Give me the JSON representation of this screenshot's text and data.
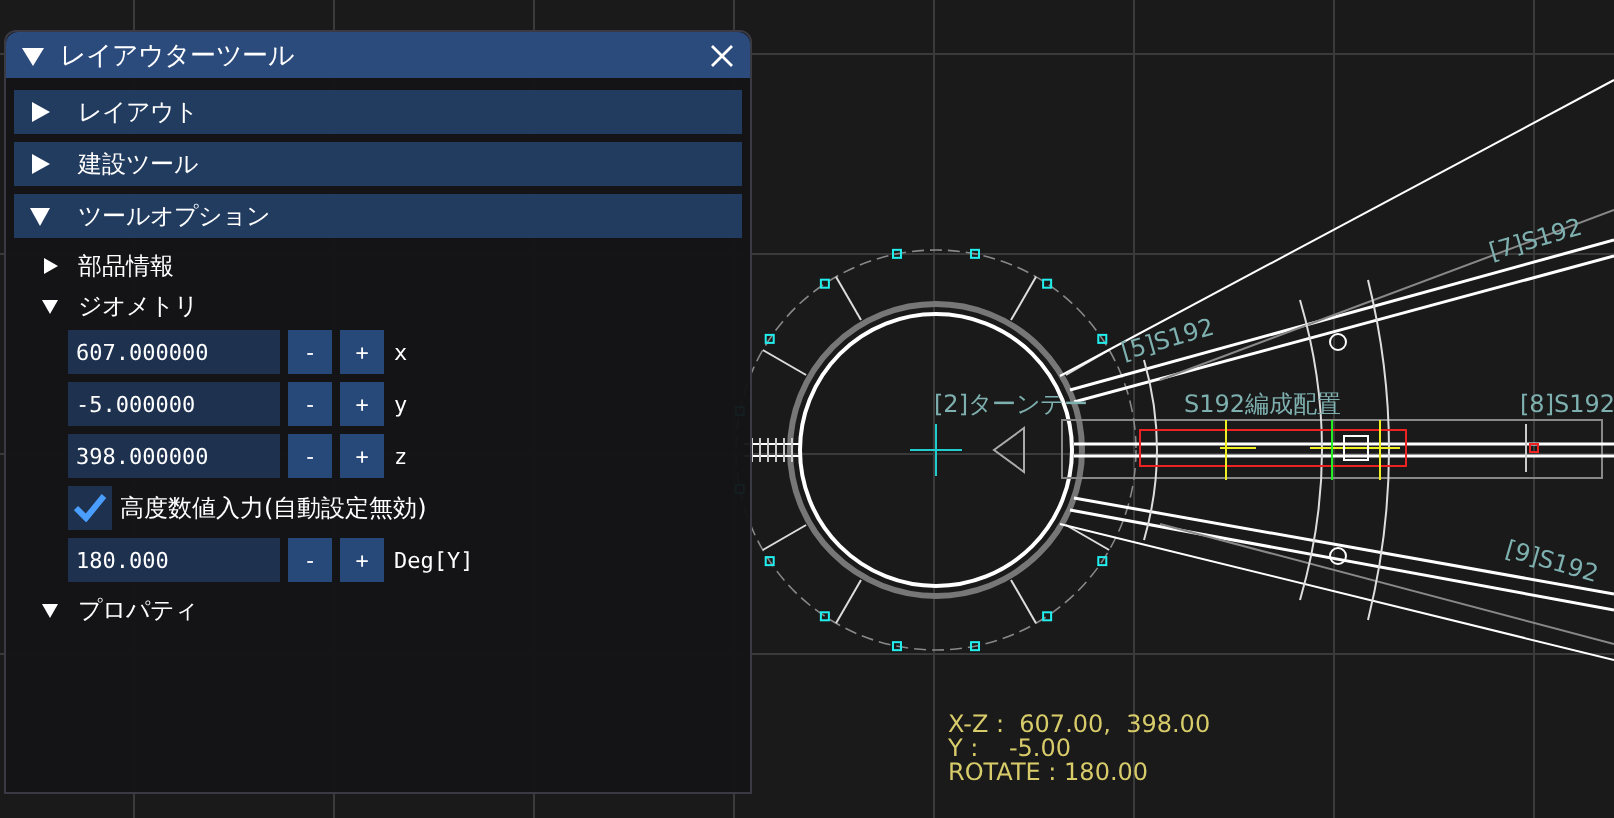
{
  "window": {
    "title": "レイアウターツール"
  },
  "sections": [
    {
      "label": "レイアウト",
      "expanded": false
    },
    {
      "label": "建設ツール",
      "expanded": false
    },
    {
      "label": "ツールオプション",
      "expanded": true
    }
  ],
  "subsections": [
    {
      "label": "部品情報",
      "expanded": false
    },
    {
      "label": "ジオメトリ",
      "expanded": true,
      "fields": [
        {
          "kind": "number",
          "value": "607.000000",
          "minus": "-",
          "plus": "+",
          "axis": "x"
        },
        {
          "kind": "number",
          "value": "-5.000000",
          "minus": "-",
          "plus": "+",
          "axis": "y"
        },
        {
          "kind": "number",
          "value": "398.000000",
          "minus": "-",
          "plus": "+",
          "axis": "z"
        },
        {
          "kind": "checkbox",
          "checked": true,
          "label": "高度数値入力(自動設定無効)"
        },
        {
          "kind": "number",
          "value": "180.000",
          "minus": "-",
          "plus": "+",
          "axis": "Deg[Y]"
        }
      ]
    },
    {
      "label": "プロパティ",
      "expanded": true
    }
  ],
  "canvas": {
    "labels": [
      "[7]S192",
      "[5]S192",
      "[2]ターンテー",
      "S192編成配置",
      "[8]S192",
      "[9]S192"
    ],
    "readout": [
      "X-Z :  607.00,  398.00",
      "Y :    -5.00",
      "ROTATE : 180.00"
    ]
  }
}
